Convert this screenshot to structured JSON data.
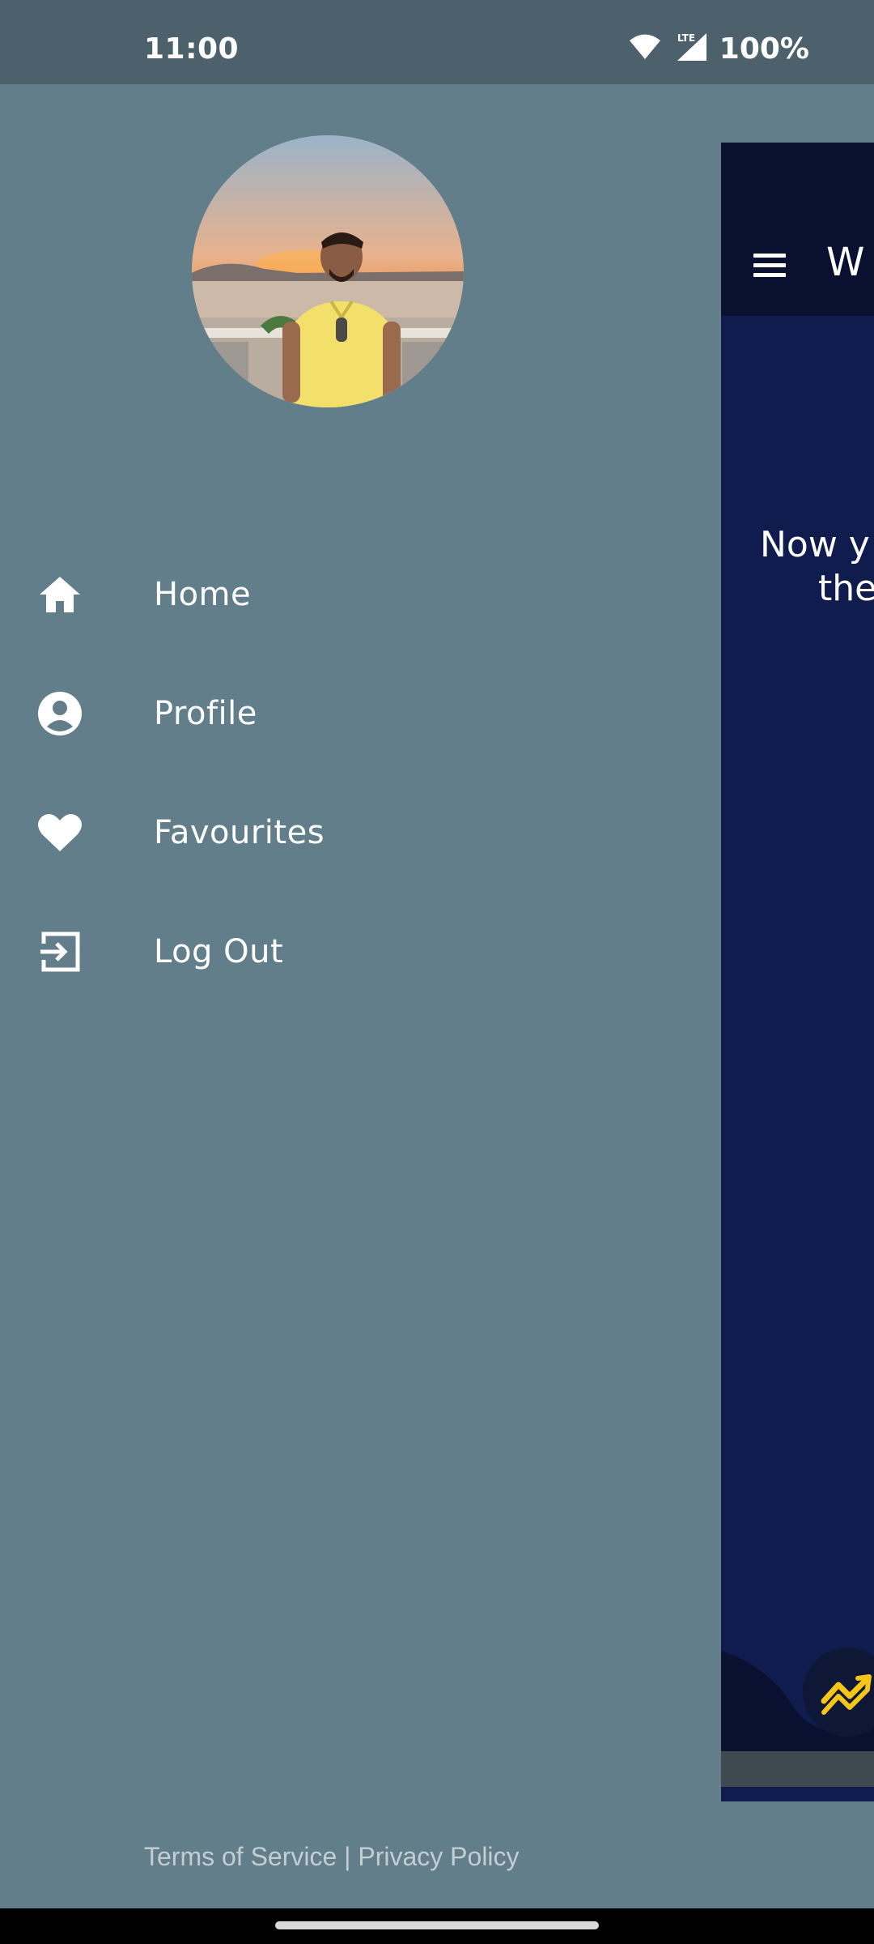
{
  "status_bar": {
    "time": "11:00",
    "battery": "100%",
    "network": "LTE",
    "icons": [
      "wifi-icon",
      "signal-icon"
    ]
  },
  "drawer": {
    "menu": [
      {
        "label": "Home",
        "icon": "home-icon"
      },
      {
        "label": "Profile",
        "icon": "account-circle-icon"
      },
      {
        "label": "Favourites",
        "icon": "heart-icon"
      },
      {
        "label": "Log Out",
        "icon": "logout-icon"
      }
    ],
    "footer": {
      "terms": "Terms of Service",
      "separator": " | ",
      "privacy": "Privacy Policy"
    }
  },
  "background_app": {
    "title_fragment": "W",
    "body_line1": "Now y",
    "body_line2": "the",
    "fab_icon": "trending-up-icon"
  },
  "colors": {
    "drawer_bg": "#627e8a",
    "status_bar_bg": "#4c616b",
    "app_bg": "#111c4e",
    "app_topbar_bg": "#0a1130",
    "accent": "#f5c518"
  }
}
